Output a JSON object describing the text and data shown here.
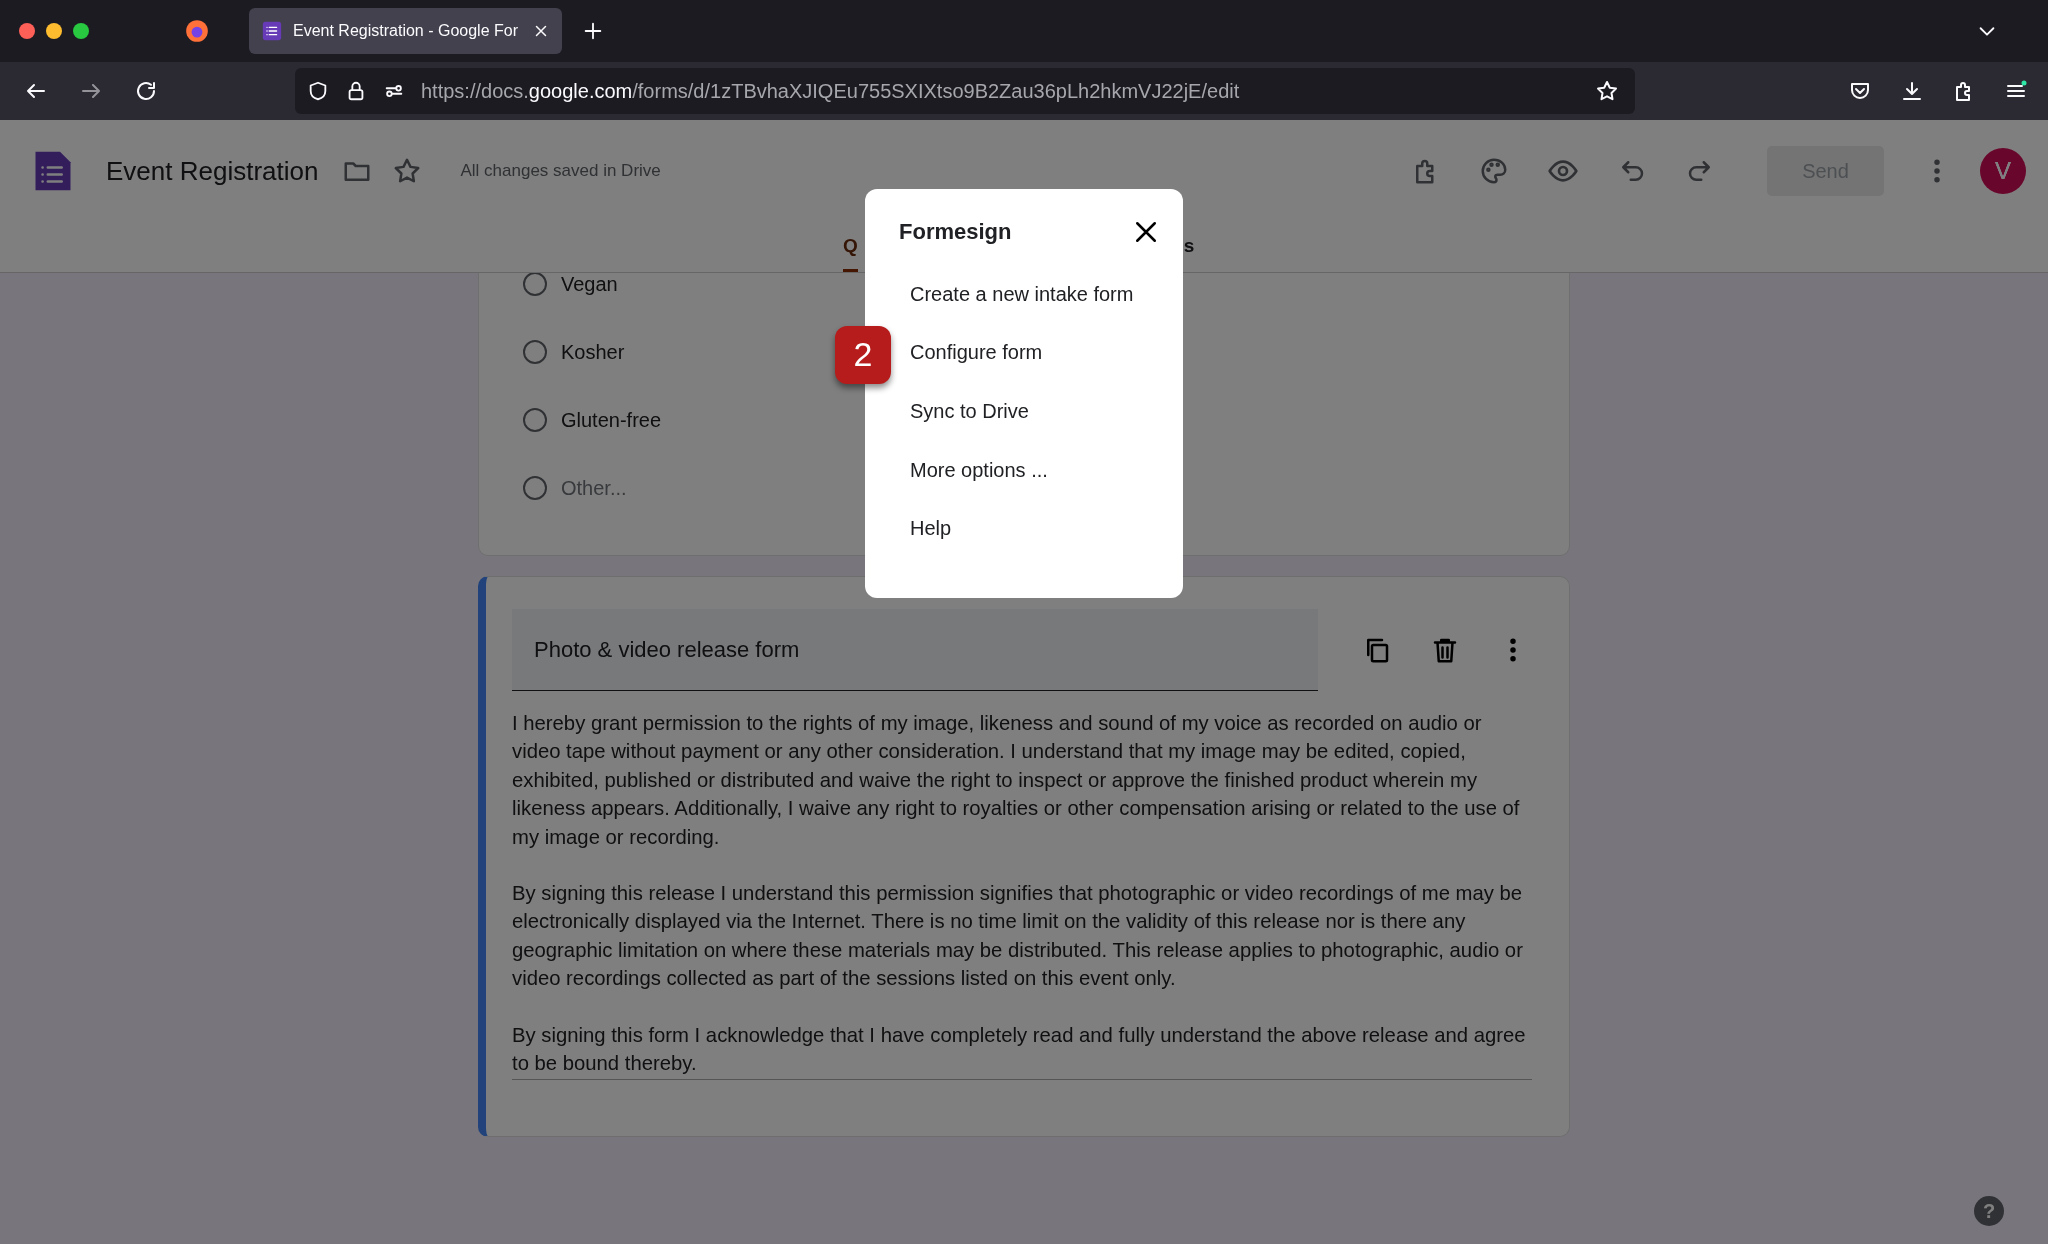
{
  "browser": {
    "tab": {
      "title": "Event Registration - Google For",
      "selected": true
    },
    "url_prefix": "https://docs.",
    "url_domain": "google.com",
    "url_path": "/forms/d/1zTBvhaXJIQEu755SXIXtso9B2Zau36pLh2hkmVJ22jE/edit"
  },
  "header": {
    "title": "Event Registration",
    "status": "All changes saved in Drive",
    "send": "Send",
    "avatar": "V"
  },
  "tabs": [
    {
      "label": "Q",
      "selected": true
    },
    {
      "label": "s",
      "selected": false
    }
  ],
  "options": [
    {
      "label": "Vegan",
      "kind": "option",
      "selected": false
    },
    {
      "label": "Kosher",
      "kind": "option",
      "selected": false
    },
    {
      "label": "Gluten-free",
      "kind": "option",
      "selected": false
    },
    {
      "label": "Other...",
      "kind": "other",
      "selected": false
    }
  ],
  "release": {
    "title": "Photo & video release form",
    "paragraphs": [
      "I hereby grant permission to the rights of my image, likeness and sound of my voice as recorded on audio or video tape without payment or any other consideration. I understand that my image may be edited, copied, exhibited, published or distributed and waive the right to inspect or approve the finished product wherein my likeness appears. Additionally, I waive any right to royalties or other compensation arising or related to the use of my image or recording.",
      "By signing this release I understand this permission signifies that photographic or video recordings of me may be electronically displayed via the Internet. There is no time limit on the validity of this release nor is there any geographic limitation on where these materials may be distributed. This release applies to photographic, audio or video recordings collected as part of the sessions listed on this event only.",
      "By signing this form I acknowledge that I have completely read and fully understand the above release and agree to be bound thereby."
    ]
  },
  "menu": {
    "title": "Formesign",
    "items": [
      {
        "label": "Create a new intake form"
      },
      {
        "label": "Configure form",
        "badge": "2"
      },
      {
        "label": "Sync to Drive"
      },
      {
        "label": "More options ..."
      },
      {
        "label": "Help"
      }
    ]
  },
  "help_button": "?"
}
